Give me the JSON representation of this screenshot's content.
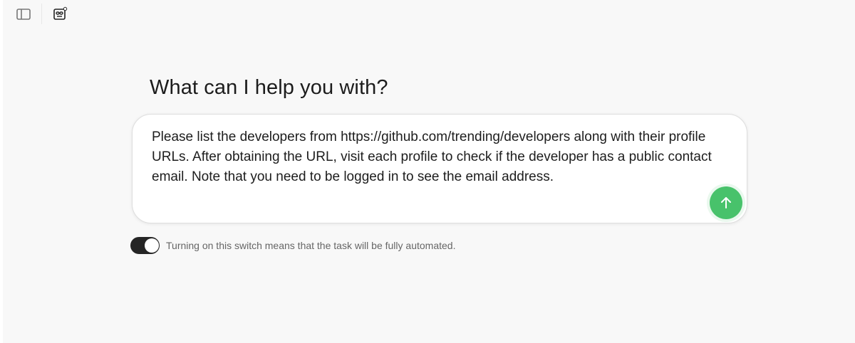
{
  "header": {
    "sidebar_toggle_icon": "sidebar-toggle-icon",
    "bot_icon": "bot-icon"
  },
  "main": {
    "heading": "What can I help you with?",
    "prompt": {
      "value": "Please list the developers from https://github.com/trending/developers along with their profile URLs. After obtaining the URL, visit each profile to check if the developer has a public contact email. Note that you need to be logged in to see the email address."
    },
    "send_icon": "arrow-up-icon",
    "automation": {
      "enabled": true,
      "label": "Turning on this switch means that the task will be fully automated."
    }
  },
  "colors": {
    "send": "#48c26b",
    "toggle_on": "#252525",
    "background": "#f8f8f8"
  }
}
